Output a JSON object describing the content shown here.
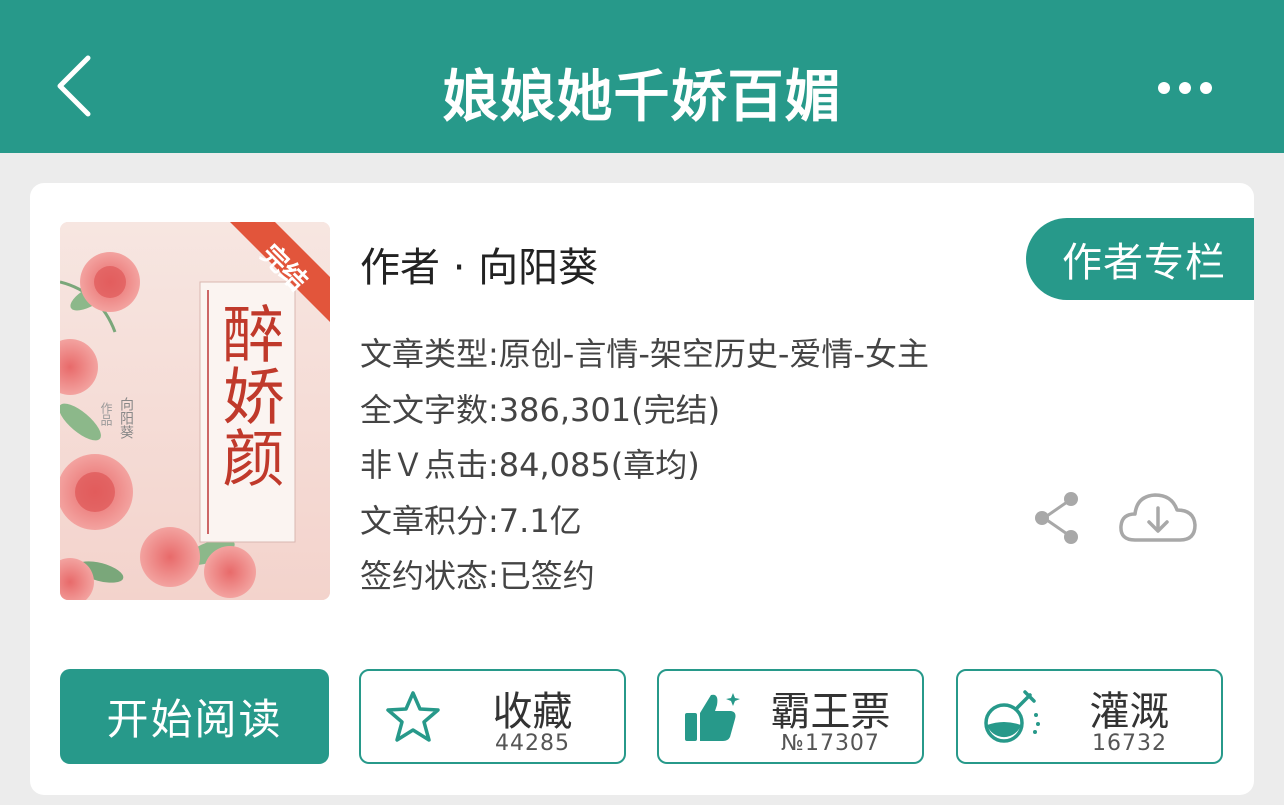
{
  "header": {
    "title": "娘娘她千娇百媚",
    "back_icon": "chevron-left-icon",
    "more_icon": "more-dots-icon",
    "color": "#27998a"
  },
  "book": {
    "cover": {
      "badge": "完结",
      "title_art": "醉娇颜",
      "author_art": "向阳葵",
      "credit_art": "作品"
    },
    "author_line": "作者 · 向阳葵",
    "author_column_label": "作者专栏",
    "meta": [
      "文章类型:原创-言情-架空历史-爱情-女主",
      "全文字数:386,301(完结)",
      "非Ｖ点击:84,085(章均)",
      "文章积分:7.1亿",
      "签约状态:已签约"
    ]
  },
  "actions": {
    "read_label": "开始阅读",
    "favorite": {
      "label": "收藏",
      "count": "44285",
      "icon": "star-icon"
    },
    "ticket": {
      "label": "霸王票",
      "count": "№17307",
      "icon": "thumbs-up-icon"
    },
    "nutrient": {
      "label": "灌溉",
      "count": "16732",
      "icon": "flask-icon"
    },
    "share_icon": "share-icon",
    "download_icon": "cloud-download-icon"
  }
}
